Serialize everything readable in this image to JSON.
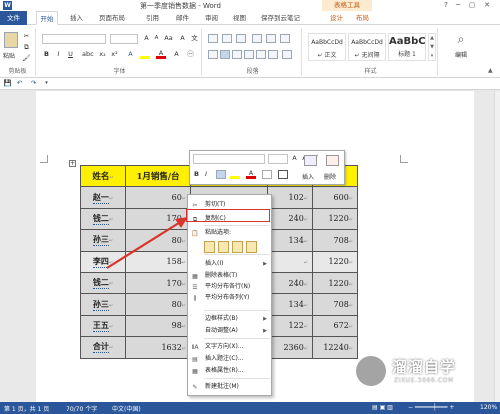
{
  "window": {
    "title": "第一季度销售数据 - Word",
    "context_title": "表格工具",
    "app_logo": "W"
  },
  "tabs": [
    "文件",
    "开始",
    "插入",
    "页面布局",
    "引用",
    "邮件",
    "审阅",
    "视图",
    "保存到云笔记",
    "设计",
    "布局"
  ],
  "ribbon": {
    "clipboard_label": "剪贴板",
    "paste_label": "粘贴",
    "font_label": "字体",
    "paragraph_label": "段落",
    "styles_label": "样式",
    "editing_label": "编辑",
    "style_gallery": [
      {
        "sample": "AaBbCcDd",
        "name": "↵ 正文"
      },
      {
        "sample": "AaBbCcDd",
        "name": "↵ 无间隔"
      },
      {
        "sample": "AaBbC",
        "name": "标题 1"
      }
    ],
    "font_color": "#e00000",
    "highlight_color": "#ffff00"
  },
  "table": {
    "headers": [
      "姓名",
      "1月销售/台"
    ],
    "rows": [
      {
        "name": "赵一",
        "jan": "60",
        "mar": "102",
        "total": "600"
      },
      {
        "name": "钱二",
        "jan": "170",
        "mar": "240",
        "total": "1220"
      },
      {
        "name": "孙三",
        "jan": "80",
        "mar": "134",
        "total": "708"
      },
      {
        "name": "李四",
        "jan": "158",
        "mar": "",
        "total": "1220"
      },
      {
        "name": "钱二",
        "jan": "170",
        "mar": "240",
        "total": "1220"
      },
      {
        "name": "孙三",
        "jan": "80",
        "mar": "134",
        "total": "708"
      },
      {
        "name": "王五",
        "jan": "98",
        "mar": "122",
        "total": "672"
      },
      {
        "name": "合计",
        "jan": "1632",
        "mar": "2360",
        "total": "12240"
      }
    ],
    "header_color": "#fff000"
  },
  "mini_toolbar": {
    "insert_label": "插入",
    "delete_label": "删除",
    "bold": "B",
    "italic": "I"
  },
  "context_menu": {
    "items": [
      {
        "label": "剪切(T)",
        "icon": "scissors-icon",
        "glyph": "✂",
        "submenu": false
      },
      {
        "label": "复制(C)",
        "icon": "copy-icon",
        "glyph": "⧉",
        "submenu": false
      },
      {
        "label": "粘贴选项:",
        "icon": "paste-icon",
        "glyph": "📋",
        "submenu": false
      },
      {
        "label": "插入(I)",
        "icon": "",
        "glyph": "",
        "submenu": true
      },
      {
        "label": "删除表格(T)",
        "icon": "delete-table-icon",
        "glyph": "▦",
        "submenu": false
      },
      {
        "label": "平均分布各行(N)",
        "icon": "distribute-rows-icon",
        "glyph": "☰",
        "submenu": false
      },
      {
        "label": "平均分布各列(Y)",
        "icon": "distribute-cols-icon",
        "glyph": "⫼",
        "submenu": false
      },
      {
        "label": "边框样式(B)",
        "icon": "",
        "glyph": "",
        "submenu": true
      },
      {
        "label": "自动调整(A)",
        "icon": "",
        "glyph": "",
        "submenu": true
      },
      {
        "label": "文字方向(X)...",
        "icon": "text-direction-icon",
        "glyph": "ⅡA",
        "submenu": false
      },
      {
        "label": "插入题注(C)...",
        "icon": "caption-icon",
        "glyph": "▤",
        "submenu": false
      },
      {
        "label": "表格属性(R)...",
        "icon": "table-properties-icon",
        "glyph": "▦",
        "submenu": false
      },
      {
        "label": "新建批注(M)",
        "icon": "comment-icon",
        "glyph": "✎",
        "submenu": false
      }
    ],
    "highlight_color": "#d9342b"
  },
  "status": {
    "page": "第 1 页，共 1 页",
    "words": "70/70 个字",
    "language": "中文(中国)",
    "zoom": "120%"
  },
  "watermark": {
    "title": "溜溜自学",
    "subtitle": "ZIXUE.3066.COM"
  }
}
